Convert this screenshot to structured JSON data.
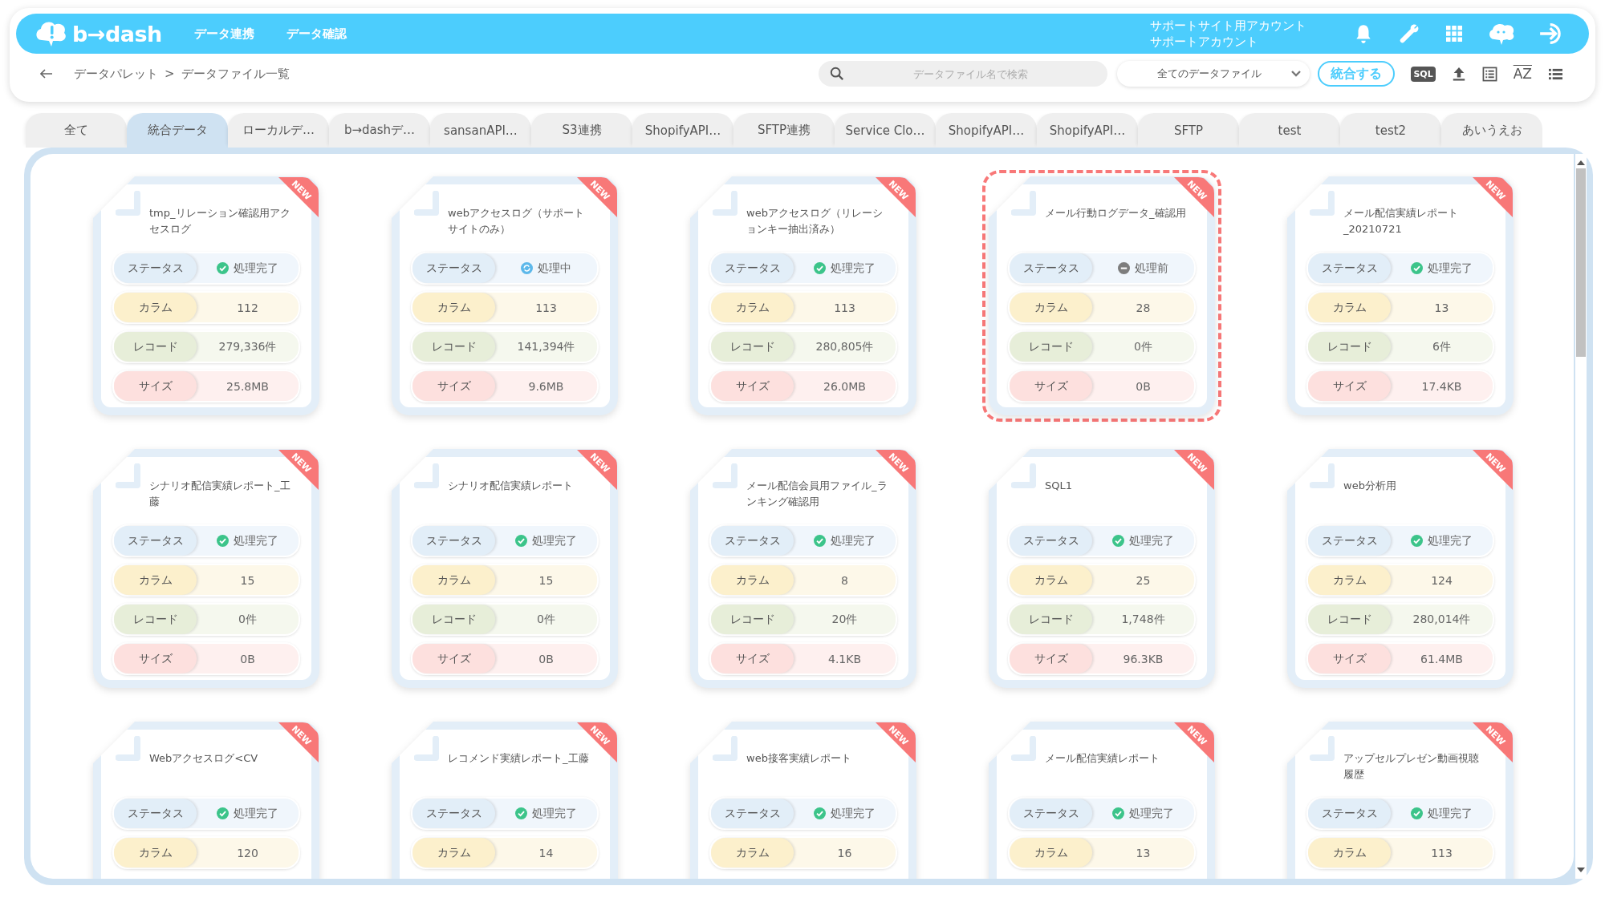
{
  "header": {
    "logo_text": "b→dash",
    "nav": [
      "データ連携",
      "データ確認"
    ],
    "account": [
      "サポートサイト用アカウント",
      "サポートアカウント"
    ]
  },
  "breadcrumb": {
    "parent": "データパレット",
    "separator": ">",
    "current": "データファイル一覧"
  },
  "toolbar": {
    "search": {
      "placeholder": "データファイル名で検索"
    },
    "filter": "全てのデータファイル",
    "merge_button": "統合する",
    "sql_label": "SQL",
    "sort_label": "AZ"
  },
  "tabs": [
    {
      "label": "全て",
      "selected": false
    },
    {
      "label": "統合データ",
      "selected": true
    },
    {
      "label": "ローカルデ…",
      "selected": false
    },
    {
      "label": "b→dashデ…",
      "selected": false
    },
    {
      "label": "sansanAPI…",
      "selected": false
    },
    {
      "label": "S3連携",
      "selected": false
    },
    {
      "label": "ShopifyAPI…",
      "selected": false
    },
    {
      "label": "SFTP連携",
      "selected": false
    },
    {
      "label": "Service Clo…",
      "selected": false
    },
    {
      "label": "ShopifyAPI…",
      "selected": false
    },
    {
      "label": "ShopifyAPI…",
      "selected": false
    },
    {
      "label": "SFTP",
      "selected": false
    },
    {
      "label": "test",
      "selected": false
    },
    {
      "label": "test2",
      "selected": false
    },
    {
      "label": "あいうえお",
      "selected": false
    }
  ],
  "cards": [
    {
      "title": "tmp_リレーション確認用アクセスログ",
      "badge": "NEW",
      "selected": false,
      "rows": [
        {
          "kind": "status",
          "label": "ステータス",
          "value": {
            "text": "処理完了",
            "kind": "done"
          }
        },
        {
          "kind": "column",
          "label": "カラム",
          "value": "112"
        },
        {
          "kind": "record",
          "label": "レコード",
          "value": "279,336件"
        },
        {
          "kind": "size",
          "label": "サイズ",
          "value": "25.8MB"
        }
      ]
    },
    {
      "title": "webアクセスログ（サポートサイトのみ）",
      "badge": "NEW",
      "selected": false,
      "rows": [
        {
          "kind": "status",
          "label": "ステータス",
          "value": {
            "text": "処理中",
            "kind": "processing"
          }
        },
        {
          "kind": "column",
          "label": "カラム",
          "value": "113"
        },
        {
          "kind": "record",
          "label": "レコード",
          "value": "141,394件"
        },
        {
          "kind": "size",
          "label": "サイズ",
          "value": "9.6MB"
        }
      ]
    },
    {
      "title": "webアクセスログ（リレーションキー抽出済み）",
      "badge": "NEW",
      "selected": false,
      "rows": [
        {
          "kind": "status",
          "label": "ステータス",
          "value": {
            "text": "処理完了",
            "kind": "done"
          }
        },
        {
          "kind": "column",
          "label": "カラム",
          "value": "113"
        },
        {
          "kind": "record",
          "label": "レコード",
          "value": "280,805件"
        },
        {
          "kind": "size",
          "label": "サイズ",
          "value": "26.0MB"
        }
      ]
    },
    {
      "title": "メール行動ログデータ_確認用",
      "badge": "NEW",
      "selected": true,
      "rows": [
        {
          "kind": "status",
          "label": "ステータス",
          "value": {
            "text": "処理前",
            "kind": "before"
          }
        },
        {
          "kind": "column",
          "label": "カラム",
          "value": "28"
        },
        {
          "kind": "record",
          "label": "レコード",
          "value": "0件"
        },
        {
          "kind": "size",
          "label": "サイズ",
          "value": "0B"
        }
      ]
    },
    {
      "title": "メール配信実績レポート_20210721",
      "badge": "NEW",
      "selected": false,
      "rows": [
        {
          "kind": "status",
          "label": "ステータス",
          "value": {
            "text": "処理完了",
            "kind": "done"
          }
        },
        {
          "kind": "column",
          "label": "カラム",
          "value": "13"
        },
        {
          "kind": "record",
          "label": "レコード",
          "value": "6件"
        },
        {
          "kind": "size",
          "label": "サイズ",
          "value": "17.4KB"
        }
      ]
    },
    {
      "title": "シナリオ配信実績レポート_工藤",
      "badge": "NEW",
      "selected": false,
      "rows": [
        {
          "kind": "status",
          "label": "ステータス",
          "value": {
            "text": "処理完了",
            "kind": "done"
          }
        },
        {
          "kind": "column",
          "label": "カラム",
          "value": "15"
        },
        {
          "kind": "record",
          "label": "レコード",
          "value": "0件"
        },
        {
          "kind": "size",
          "label": "サイズ",
          "value": "0B"
        }
      ]
    },
    {
      "title": "シナリオ配信実績レポート",
      "badge": "NEW",
      "selected": false,
      "rows": [
        {
          "kind": "status",
          "label": "ステータス",
          "value": {
            "text": "処理完了",
            "kind": "done"
          }
        },
        {
          "kind": "column",
          "label": "カラム",
          "value": "15"
        },
        {
          "kind": "record",
          "label": "レコード",
          "value": "0件"
        },
        {
          "kind": "size",
          "label": "サイズ",
          "value": "0B"
        }
      ]
    },
    {
      "title": "メール配信会員用ファイル_ランキング確認用",
      "badge": "NEW",
      "selected": false,
      "rows": [
        {
          "kind": "status",
          "label": "ステータス",
          "value": {
            "text": "処理完了",
            "kind": "done"
          }
        },
        {
          "kind": "column",
          "label": "カラム",
          "value": "8"
        },
        {
          "kind": "record",
          "label": "レコード",
          "value": "20件"
        },
        {
          "kind": "size",
          "label": "サイズ",
          "value": "4.1KB"
        }
      ]
    },
    {
      "title": "SQL1",
      "badge": "NEW",
      "selected": false,
      "rows": [
        {
          "kind": "status",
          "label": "ステータス",
          "value": {
            "text": "処理完了",
            "kind": "done"
          }
        },
        {
          "kind": "column",
          "label": "カラム",
          "value": "25"
        },
        {
          "kind": "record",
          "label": "レコード",
          "value": "1,748件"
        },
        {
          "kind": "size",
          "label": "サイズ",
          "value": "96.3KB"
        }
      ]
    },
    {
      "title": "web分析用",
      "badge": "NEW",
      "selected": false,
      "rows": [
        {
          "kind": "status",
          "label": "ステータス",
          "value": {
            "text": "処理完了",
            "kind": "done"
          }
        },
        {
          "kind": "column",
          "label": "カラム",
          "value": "124"
        },
        {
          "kind": "record",
          "label": "レコード",
          "value": "280,014件"
        },
        {
          "kind": "size",
          "label": "サイズ",
          "value": "61.4MB"
        }
      ]
    },
    {
      "title": "Webアクセスログ<CV",
      "badge": "NEW",
      "selected": false,
      "rows": [
        {
          "kind": "status",
          "label": "ステータス",
          "value": {
            "text": "処理完了",
            "kind": "done"
          }
        },
        {
          "kind": "column",
          "label": "カラム",
          "value": "120"
        }
      ]
    },
    {
      "title": "レコメンド実績レポート_工藤",
      "badge": "NEW",
      "selected": false,
      "rows": [
        {
          "kind": "status",
          "label": "ステータス",
          "value": {
            "text": "処理完了",
            "kind": "done"
          }
        },
        {
          "kind": "column",
          "label": "カラム",
          "value": "14"
        }
      ]
    },
    {
      "title": "web接客実績レポート",
      "badge": "NEW",
      "selected": false,
      "rows": [
        {
          "kind": "status",
          "label": "ステータス",
          "value": {
            "text": "処理完了",
            "kind": "done"
          }
        },
        {
          "kind": "column",
          "label": "カラム",
          "value": "16"
        }
      ]
    },
    {
      "title": "メール配信実績レポート",
      "badge": "NEW",
      "selected": false,
      "rows": [
        {
          "kind": "status",
          "label": "ステータス",
          "value": {
            "text": "処理完了",
            "kind": "done"
          }
        },
        {
          "kind": "column",
          "label": "カラム",
          "value": "13"
        }
      ]
    },
    {
      "title": "アップセルプレゼン動画視聴履歴",
      "badge": "NEW",
      "selected": false,
      "rows": [
        {
          "kind": "status",
          "label": "ステータス",
          "value": {
            "text": "処理完了",
            "kind": "done"
          }
        },
        {
          "kind": "column",
          "label": "カラム",
          "value": "113"
        }
      ]
    }
  ]
}
